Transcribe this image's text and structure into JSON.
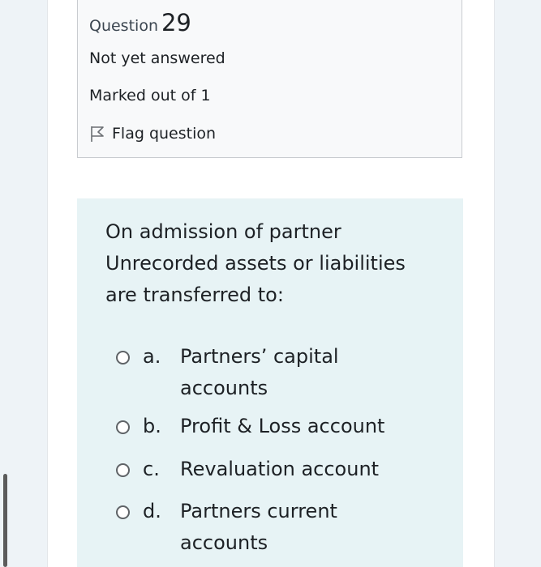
{
  "question_info": {
    "label": "Question",
    "number": "29",
    "state": "Not yet answered",
    "grade": "Marked out of 1",
    "flag_label": "Flag question"
  },
  "question": {
    "text": "On admission of partner Unrecorded assets or liabilities are transferred to:",
    "options": [
      {
        "letter": "a.",
        "text": "Partners’ capital accounts"
      },
      {
        "letter": "b.",
        "text": "Profit & Loss account"
      },
      {
        "letter": "c.",
        "text": "Revaluation account"
      },
      {
        "letter": "d.",
        "text": "Partners current accounts"
      }
    ]
  },
  "colors": {
    "page_background": "#eef3f7",
    "info_box_background": "#f8f9fa",
    "question_box_background": "#e7f3f5",
    "text": "#1d2125"
  }
}
